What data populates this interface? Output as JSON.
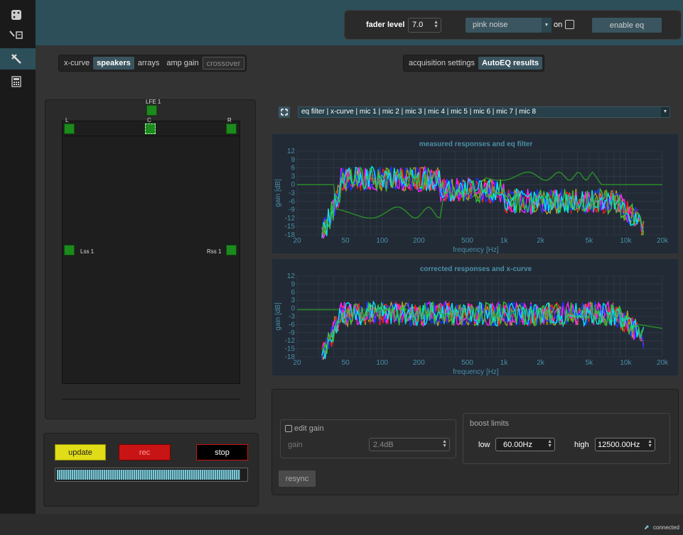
{
  "sidebar": {
    "icons": [
      "dice-icon",
      "edit-icon",
      "tools-icon",
      "calculator-icon"
    ]
  },
  "topbar": {
    "fader_label": "fader level",
    "fader_value": "7.0",
    "noise_select": "pink noise",
    "on_label": "on",
    "enable_eq_label": "enable eq"
  },
  "left_tabs": [
    {
      "label": "x-curve",
      "state": "normal"
    },
    {
      "label": "speakers",
      "state": "active"
    },
    {
      "label": "arrays",
      "state": "normal"
    },
    {
      "label": "amp gain",
      "state": "normal"
    },
    {
      "label": "crossover",
      "state": "disabled"
    }
  ],
  "right_tabs": [
    {
      "label": "acquisition settings",
      "state": "normal"
    },
    {
      "label": "AutoEQ results",
      "state": "active"
    }
  ],
  "speakers": {
    "lfe": "LFE 1",
    "left": "L",
    "center": "C",
    "right": "R",
    "lss": "Lss 1",
    "rss": "Rss 1"
  },
  "controls": {
    "update": "update",
    "rec": "rec",
    "stop": "stop",
    "meter_level": 0.97
  },
  "plot_selector": "eq filter | x-curve | mic 1 | mic 2 | mic 3 | mic 4 | mic 5 | mic 6 | mic 7 | mic 8",
  "plots": [
    {
      "title": "measured responses and eq filter"
    },
    {
      "title": "corrected responses and x-curve"
    }
  ],
  "axes": {
    "ylabel": "gain [dB]",
    "xlabel": "frequency [Hz]",
    "yticks": [
      "12",
      "9",
      "6",
      "3",
      "0",
      "-3",
      "-6",
      "-9",
      "-12",
      "-15",
      "-18"
    ],
    "xticks": [
      "20",
      "50",
      "100",
      "200",
      "500",
      "1k",
      "2k",
      "5k",
      "10k",
      "20k"
    ]
  },
  "gain_panel": {
    "edit_gain_label": "edit gain",
    "gain_label": "gain",
    "gain_value": "2.4dB",
    "resync_label": "resync"
  },
  "boost": {
    "title": "boost limits",
    "low_label": "low",
    "low_value": "60.00Hz",
    "high_label": "high",
    "high_value": "12500.00Hz"
  },
  "status": {
    "connection": "connected"
  },
  "colors": {
    "topbar": "#2c4f5a",
    "accent": "#3a5560",
    "speaker": "#1c8a1c",
    "update": "#e0dc18",
    "rec": "#c81414",
    "stop": "#000000",
    "meter": "#7fc8d6",
    "plot_title": "#4a8fa6",
    "series": [
      "#2a8a2a",
      "#b0a020",
      "#ff1a1a",
      "#ff22ff",
      "#2030ff",
      "#00e5ff",
      "#33c033",
      "#ffffff"
    ]
  }
}
